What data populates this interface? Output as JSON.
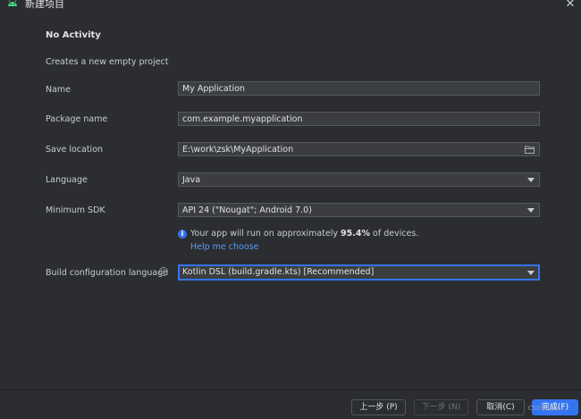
{
  "window": {
    "title": "新建项目",
    "close_glyph": "✕",
    "app_icon": "android-icon"
  },
  "form": {
    "heading": "No Activity",
    "subheading": "Creates a new empty project",
    "name": {
      "label": "Name",
      "value": "My Application"
    },
    "package": {
      "label": "Package name",
      "value": "com.example.myapplication"
    },
    "location": {
      "label": "Save location",
      "value": "E:\\work\\zsk\\MyApplication",
      "icon": "folder-icon"
    },
    "language": {
      "label": "Language",
      "value": "Java"
    },
    "min_sdk": {
      "label": "Minimum SDK",
      "value": "API 24 (\"Nougat\"; Android 7.0)"
    },
    "sdk_info": {
      "prefix": "Your app will run on approximately ",
      "percent": "95.4%",
      "suffix": " of devices.",
      "help_link": "Help me choose"
    },
    "build_lang": {
      "label": "Build configuration language",
      "value": "Kotlin DSL (build.gradle.kts) [Recommended]",
      "help_glyph": "?"
    }
  },
  "footer": {
    "prev_label": "上一步 (P)",
    "next_label": "下一步 (N)",
    "cancel_label": "取消(C)",
    "finish_label": "完成(F)",
    "watermark": "CSDN @zsk..."
  },
  "colors": {
    "background": "#2b2d30",
    "field_bg": "#3b3d40",
    "accent": "#3574f0",
    "link": "#589df6",
    "android_green": "#3ddc84"
  }
}
